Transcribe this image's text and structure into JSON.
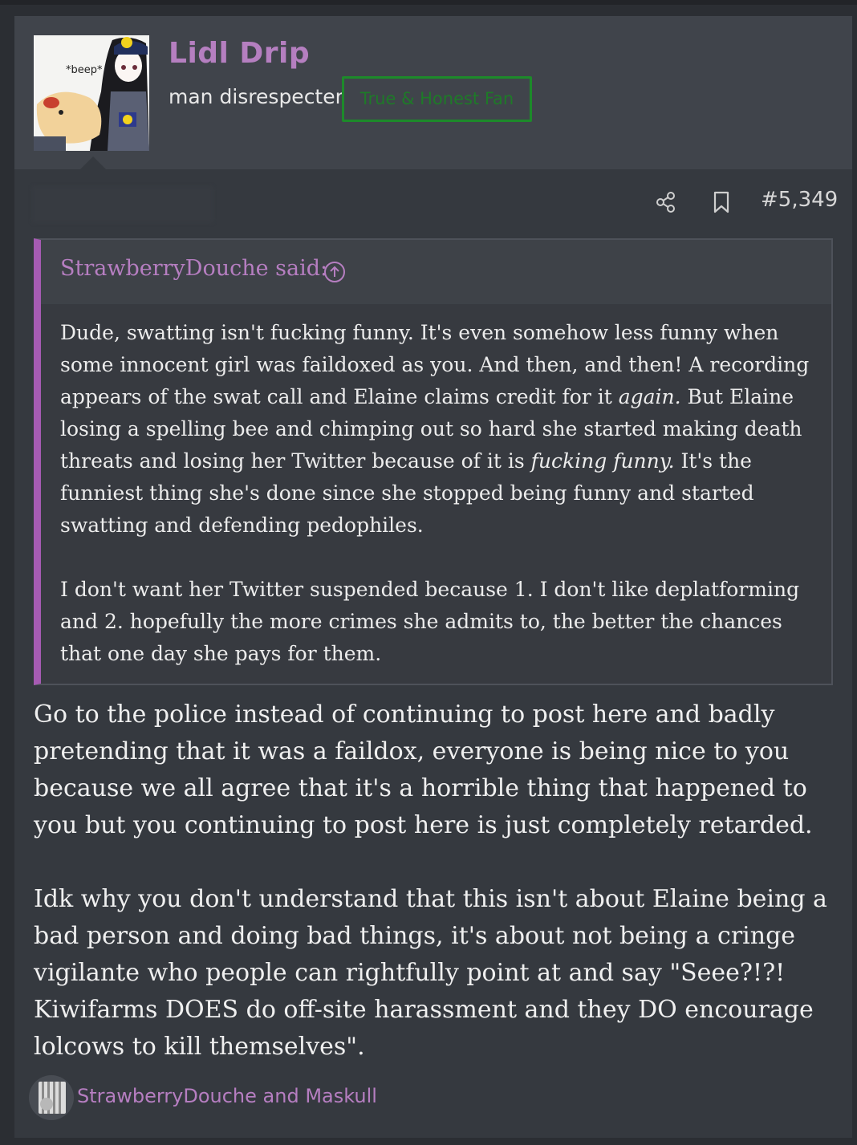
{
  "post": {
    "username": "Lidl Drip",
    "user_title": "man disrespecter",
    "user_banner": "True & Honest Fan",
    "avatar_caption": "*beep*",
    "post_number": "#5,349",
    "icons": {
      "share": "share-icon",
      "bookmark": "bookmark-icon",
      "expand": "arrow-up-circle-icon"
    }
  },
  "quote": {
    "author_label": "StrawberryDouche said:",
    "paragraph1_a": "Dude, swatting isn't fucking funny. It's even somehow less funny when some innocent girl was faildoxed as you. And then, and then! A recording appears of the swat call and Elaine claims credit for it ",
    "paragraph1_em1": "again.",
    "paragraph1_b": " But Elaine losing a spelling bee and chimping out so hard she started making death threats and losing her Twitter because of it is ",
    "paragraph1_em2": "fucking funny.",
    "paragraph1_c": " It's the funniest thing she's done since she stopped being funny and started swatting and defending pedophiles.",
    "paragraph2": "I don't want her Twitter suspended because 1. I don't like deplatforming and 2. hopefully the more crimes she admits to, the better the chances that one day she pays for them."
  },
  "body": {
    "paragraph1": "Go to the police instead of continuing to post here and badly pretending that it was a faildox, everyone is being nice to you because we all agree that it's a horrible thing that happened to you but you continuing to post here is just completely retarded.",
    "paragraph2": "Idk why you don't understand that this isn't about Elaine being a bad person and doing bad things, it's about not being a cringe vigilante who people can rightfully point at and say \"Seee?!?! Kiwifarms DOES do off-site harassment and they DO encourage lolcows to kill themselves\"."
  },
  "reactions": {
    "text": "StrawberryDouche and Maskull",
    "icon": "prison-bars-icon"
  },
  "colors": {
    "accent": "#b57fc0",
    "quote_bar": "#a65bb3",
    "banner_green": "#1d8a2a",
    "background": "#2b2e33",
    "post_bg": "#35393f"
  }
}
